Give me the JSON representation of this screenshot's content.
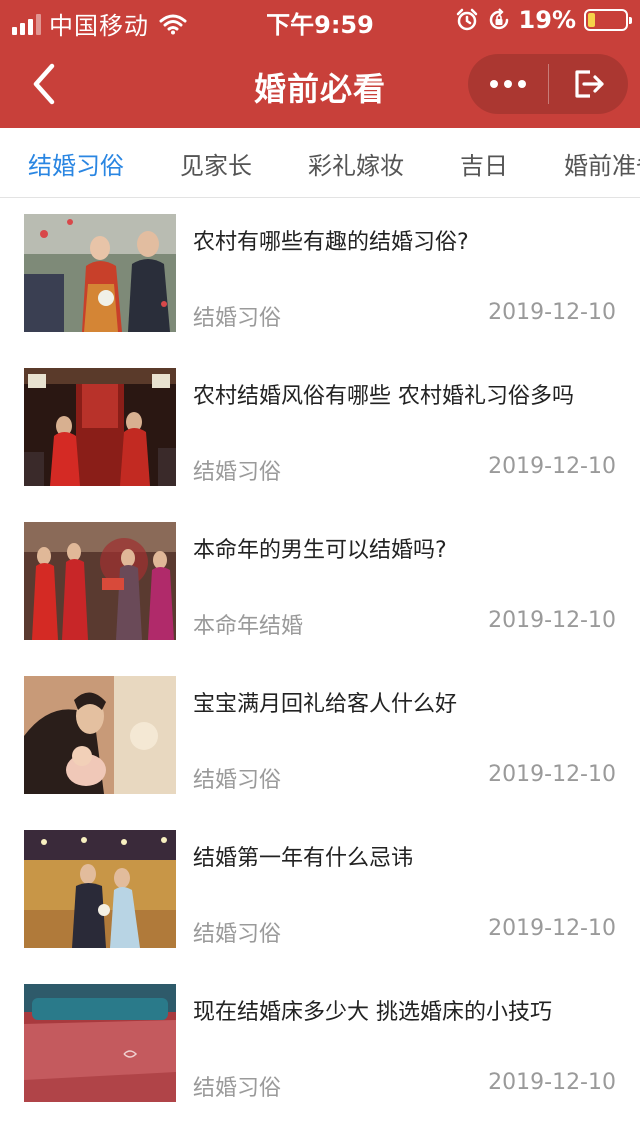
{
  "status_bar": {
    "carrier": "中国移动",
    "time": "下午9:59",
    "battery_percent": "19%",
    "battery_level": 0.19,
    "battery_color": "#f6d34a",
    "icons": [
      "signal-icon",
      "wifi-icon",
      "alarm-icon",
      "rotation-lock-icon",
      "battery-icon"
    ]
  },
  "header": {
    "title": "婚前必看",
    "background": "#c8403a",
    "back_icon": "chevron-left-icon",
    "more_icon": "more-dots-icon",
    "exit_icon": "exit-icon"
  },
  "tabs": [
    {
      "label": "结婚习俗",
      "active": true
    },
    {
      "label": "见家长",
      "active": false
    },
    {
      "label": "彩礼嫁妆",
      "active": false
    },
    {
      "label": "吉日",
      "active": false
    },
    {
      "label": "婚前准备",
      "active": false
    }
  ],
  "accent_color": "#2a86e2",
  "articles": [
    {
      "title": "农村有哪些有趣的结婚习俗?",
      "category": "结婚习俗",
      "date": "2019-12-10"
    },
    {
      "title": "农村结婚风俗有哪些 农村婚礼习俗多吗",
      "category": "结婚习俗",
      "date": "2019-12-10"
    },
    {
      "title": "本命年的男生可以结婚吗?",
      "category": "本命年结婚",
      "date": "2019-12-10"
    },
    {
      "title": "宝宝满月回礼给客人什么好",
      "category": "结婚习俗",
      "date": "2019-12-10"
    },
    {
      "title": "结婚第一年有什么忌讳",
      "category": "结婚习俗",
      "date": "2019-12-10"
    },
    {
      "title": "现在结婚床多少大 挑选婚床的小技巧",
      "category": "结婚习俗",
      "date": "2019-12-10"
    }
  ]
}
